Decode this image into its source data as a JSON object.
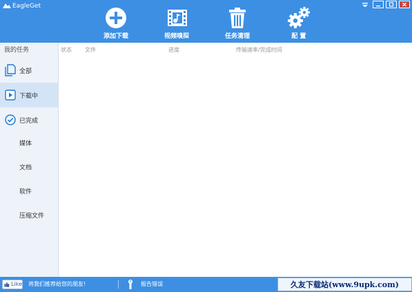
{
  "window": {
    "title": "EagleGet",
    "controls": [
      "dropdown-icon",
      "minimize-icon",
      "maximize-icon",
      "close-icon"
    ]
  },
  "toolbar": {
    "items": [
      {
        "label": "添加下载",
        "icon": "add-circle-icon"
      },
      {
        "label": "视频嗅探",
        "icon": "video-sniffer-icon"
      },
      {
        "label": "任务清理",
        "icon": "trash-icon"
      },
      {
        "label": "配 置",
        "icon": "gears-icon"
      }
    ]
  },
  "sidebar": {
    "title": "我的任务",
    "items": [
      {
        "label": "全部",
        "icon": "document-icon",
        "active": false
      },
      {
        "label": "下载中",
        "icon": "play-icon",
        "active": true
      },
      {
        "label": "已完成",
        "icon": "check-circle-icon",
        "active": false
      }
    ],
    "categories": [
      "媒体",
      "文档",
      "软件",
      "压缩文件"
    ]
  },
  "list": {
    "columns": [
      "状态",
      "文件",
      "进度",
      "传输速率/完成时间"
    ]
  },
  "statusbar": {
    "like_label": "Like",
    "recommend": "将我们推荐给您的朋友!",
    "report": "报告错误",
    "watermark": "久友下载站(www.9upk.com)"
  },
  "colors": {
    "header_bg": "#3d8fe3",
    "sidebar_bg": "#eef3fa",
    "active_item_bg": "#d4e4f7",
    "icon_blue": "#1e7ad6"
  }
}
